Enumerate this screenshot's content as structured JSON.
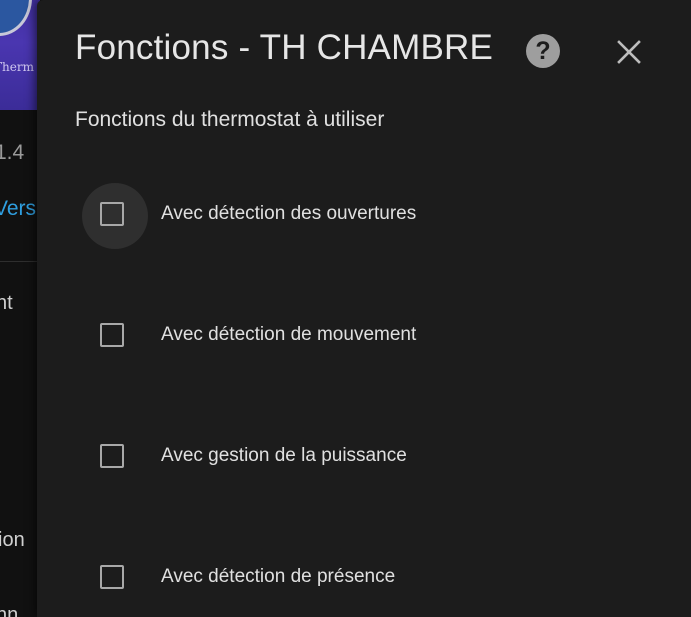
{
  "background": {
    "logo_text": "Therm",
    "version_text": "1.4",
    "link_text": "Versio",
    "menu_items": [
      "nt",
      "ion",
      "nn"
    ]
  },
  "dialog": {
    "title": "Fonctions - TH CHAMBRE",
    "help_icon": "help-circle-icon",
    "help_glyph": "?",
    "close_icon": "close-icon",
    "section_label": "Fonctions du thermostat à utiliser",
    "options": [
      {
        "label": "Avec détection des ouvertures",
        "checked": false,
        "focused": true
      },
      {
        "label": "Avec détection de mouvement",
        "checked": false,
        "focused": false
      },
      {
        "label": "Avec gestion de la puissance",
        "checked": false,
        "focused": false
      },
      {
        "label": "Avec détection de présence",
        "checked": false,
        "focused": false
      }
    ]
  },
  "colors": {
    "dialog_bg": "#1c1c1c",
    "text": "#e0e0e0",
    "checkbox_border": "#a8a8a8",
    "link": "#2f9fe0"
  }
}
